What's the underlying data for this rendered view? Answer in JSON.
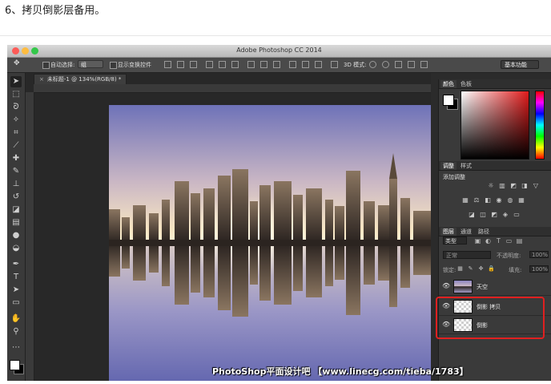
{
  "caption": "6、拷贝倒影层备用。",
  "app": {
    "title": "Adobe Photoshop CC 2014"
  },
  "options_bar": {
    "auto_select_label": "自动选择:",
    "auto_select_value": "组",
    "show_transform_label": "显示变换控件",
    "mode_3d_label": "3D 模式:",
    "workspace_preset": "基本功能"
  },
  "document": {
    "tab_label": "未标题-1 @ 134%(RGB/8) *"
  },
  "panels": {
    "color_tabs": [
      "颜色",
      "色板"
    ],
    "adjust_tabs": [
      "调整",
      "样式"
    ],
    "adjust_title": "添加调整",
    "layers_tabs": [
      "图层",
      "通道",
      "路径"
    ],
    "kind_filter": "类型",
    "blend_mode": "正常",
    "opacity_label": "不透明度:",
    "opacity_value": "100%",
    "lock_label": "锁定:",
    "fill_label": "填充:",
    "fill_value": "100%"
  },
  "layers": [
    {
      "name": "天空",
      "visible": true
    },
    {
      "name": "倒影 拷贝",
      "visible": true
    },
    {
      "name": "倒影",
      "visible": true
    }
  ],
  "watermark": "PhotoShop平面设计吧 【www.linecg.com/tieba/1783】",
  "colors": {
    "highlight": "#e02020",
    "ui_dark": "#3a3a3a"
  }
}
